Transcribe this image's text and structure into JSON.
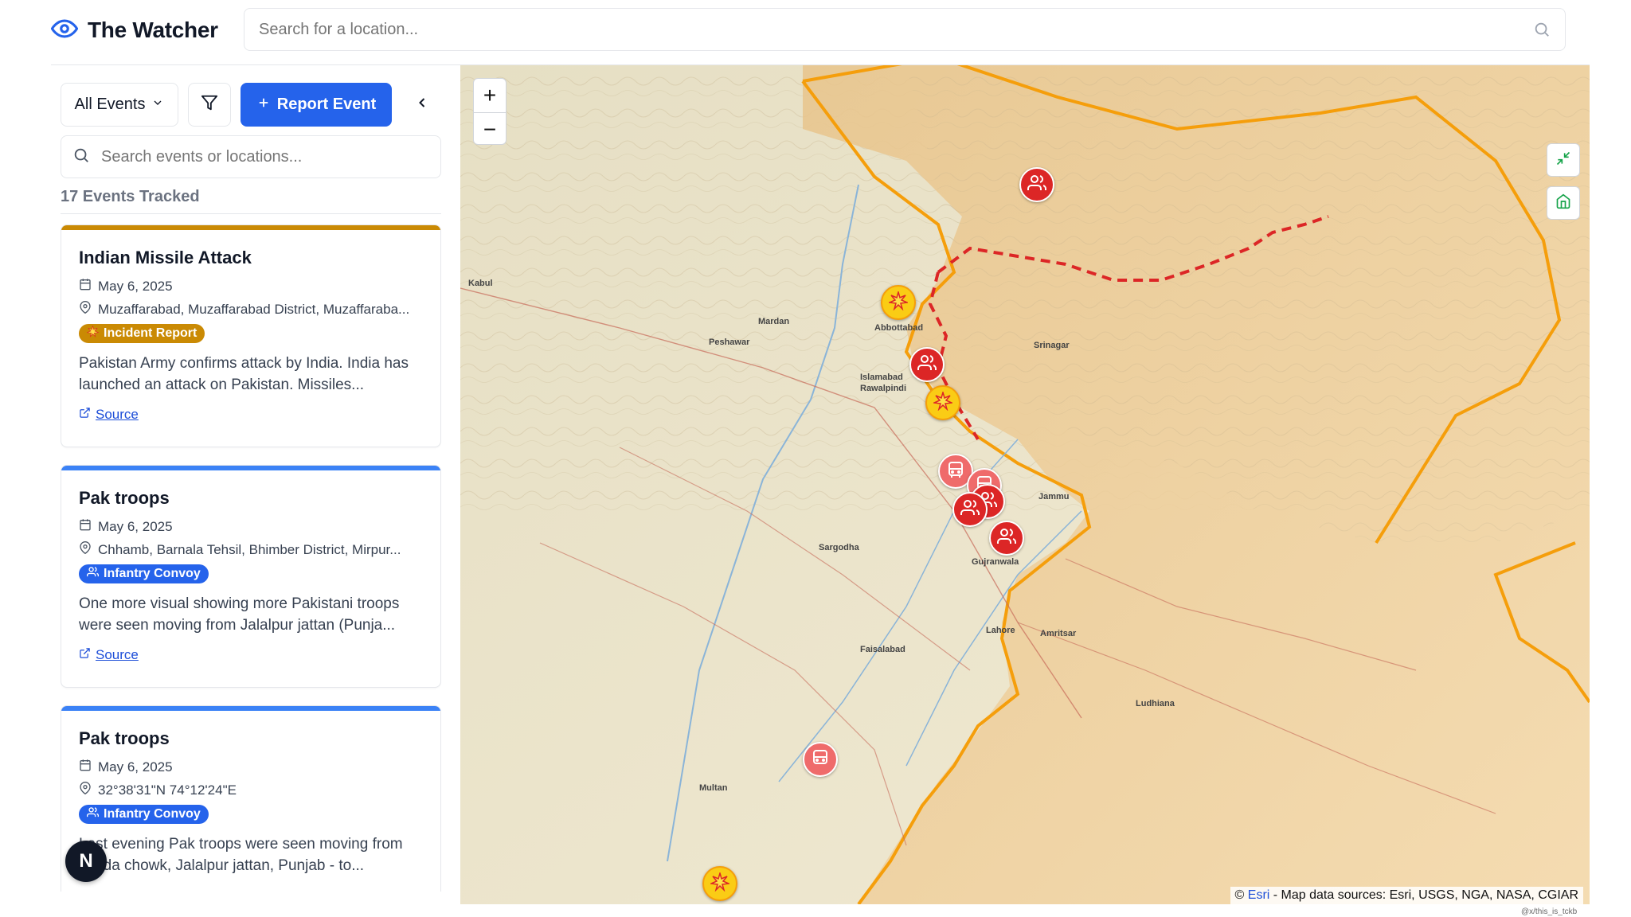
{
  "app": {
    "title": "The Watcher"
  },
  "top_search": {
    "placeholder": "Search for a location..."
  },
  "toolbar": {
    "filter_label": "All Events",
    "report_label": "Report Event"
  },
  "sidebar_search": {
    "placeholder": "Search events or locations..."
  },
  "events_count": "17 Events Tracked",
  "events": [
    {
      "title": "Indian Missile Attack",
      "date": "May 6, 2025",
      "location": "Muzaffarabad, Muzaffarabad District, Muzaffaraba...",
      "badge": "Incident Report",
      "badge_color": "#ca8a04",
      "accent": "#ca8a04",
      "description": "Pakistan Army confirms attack by India. India has launched an attack on Pakistan. Missiles...",
      "source": "Source"
    },
    {
      "title": "Pak troops",
      "date": "May 6, 2025",
      "location": "Chhamb, Barnala Tehsil, Bhimber District, Mirpur...",
      "badge": "Infantry Convoy",
      "badge_color": "#2563eb",
      "accent": "#3b82f6",
      "description": "One more visual showing more Pakistani troops were seen moving from Jalalpur jattan (Punja...",
      "source": "Source"
    },
    {
      "title": "Pak troops",
      "date": "May 6, 2025",
      "location": "32°38'31\"N 74°12'24\"E",
      "badge": "Infantry Convoy",
      "badge_color": "#2563eb",
      "accent": "#3b82f6",
      "description": "Last evening Pak troops were seen moving from Tanda chowk, Jalalpur jattan, Punjab - to...",
      "source": "Source"
    }
  ],
  "nav_letter": "N",
  "map": {
    "zoom_in": "+",
    "zoom_out": "−",
    "attribution_prefix": "©",
    "attribution_link": "Esri",
    "attribution_text": " - Map data sources: Esri, USGS, NGA, NASA, CGIAR",
    "labels": [
      "Kabul",
      "Peshawar",
      "Mardan",
      "Islamabad",
      "Rawalpindi",
      "Srinagar",
      "Jammu",
      "Gujranwala",
      "Lahore",
      "Amritsar",
      "Faisalabad",
      "Multan",
      "Ludhiana",
      "Sargodha",
      "Abbottabad"
    ],
    "markers": [
      {
        "type": "infantry",
        "color": "red"
      },
      {
        "type": "incident",
        "color": "yellow"
      },
      {
        "type": "infantry",
        "color": "red"
      },
      {
        "type": "incident",
        "color": "yellow"
      },
      {
        "type": "convoy",
        "color": "pink"
      },
      {
        "type": "convoy",
        "color": "pink"
      },
      {
        "type": "infantry",
        "color": "red"
      },
      {
        "type": "infantry",
        "color": "red"
      },
      {
        "type": "infantry",
        "color": "red"
      },
      {
        "type": "convoy",
        "color": "pink"
      },
      {
        "type": "incident",
        "color": "yellow"
      }
    ]
  },
  "watermark": "@x/this_is_tckb"
}
